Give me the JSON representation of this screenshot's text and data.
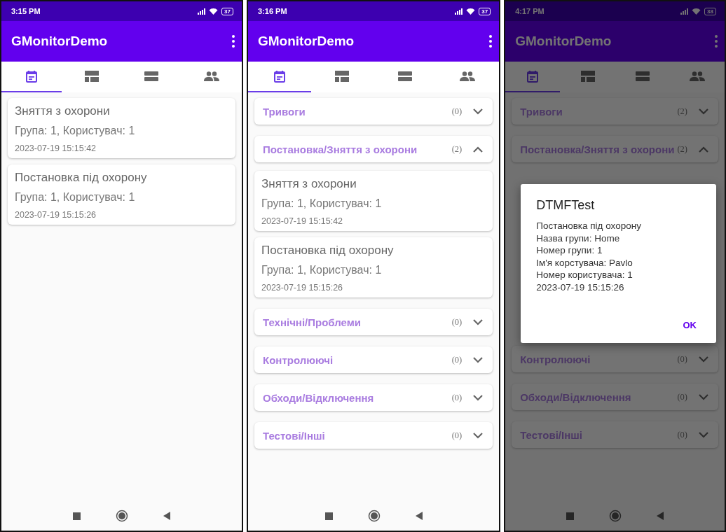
{
  "screens": [
    {
      "status_bar": {
        "time": "3:15 PM",
        "battery": "37"
      },
      "app_bar": {
        "title": "GMonitorDemo"
      },
      "tabs": [
        {
          "kind": "calendar",
          "selected": true
        },
        {
          "kind": "dashboard",
          "selected": false
        },
        {
          "kind": "list",
          "selected": false
        },
        {
          "kind": "people",
          "selected": false
        }
      ],
      "events": [
        {
          "title": "Зняття з охорони",
          "details": "Група: 1, Користувач: 1",
          "time": "2023-07-19 15:15:42"
        },
        {
          "title": "Постановка під охорону",
          "details": "Група: 1, Користувач: 1",
          "time": "2023-07-19 15:15:26"
        }
      ]
    },
    {
      "status_bar": {
        "time": "3:16 PM",
        "battery": "37"
      },
      "app_bar": {
        "title": "GMonitorDemo"
      },
      "tabs": [
        {
          "kind": "calendar",
          "selected": true
        },
        {
          "kind": "dashboard",
          "selected": false
        },
        {
          "kind": "list",
          "selected": false
        },
        {
          "kind": "people",
          "selected": false
        }
      ],
      "sections": [
        {
          "title": "Тривоги",
          "count": "(0)",
          "expanded": false
        },
        {
          "title": "Постановка/Зняття з охорони",
          "count": "(2)",
          "expanded": true,
          "events": [
            {
              "title": "Зняття з охорони",
              "details": "Група: 1, Користувач: 1",
              "time": "2023-07-19 15:15:42"
            },
            {
              "title": "Постановка під охорону",
              "details": "Група: 1, Користувач: 1",
              "time": "2023-07-19 15:15:26"
            }
          ]
        },
        {
          "title": "Технічні/Проблеми",
          "count": "(0)",
          "expanded": false
        },
        {
          "title": "Контролюючі",
          "count": "(0)",
          "expanded": false
        },
        {
          "title": "Обходи/Відключення",
          "count": "(0)",
          "expanded": false
        },
        {
          "title": "Тестові/Інші",
          "count": "(0)",
          "expanded": false
        }
      ]
    },
    {
      "status_bar": {
        "time": "4:17 PM",
        "battery": "38"
      },
      "app_bar": {
        "title": "GMonitorDemo"
      },
      "tabs": [
        {
          "kind": "calendar",
          "selected": true
        },
        {
          "kind": "dashboard",
          "selected": false
        },
        {
          "kind": "list",
          "selected": false
        },
        {
          "kind": "people",
          "selected": false
        }
      ],
      "sections": [
        {
          "title": "Тривоги",
          "count": "(2)",
          "expanded": false
        },
        {
          "title": "Постановка/Зняття з охорони",
          "count": "(2)",
          "expanded": true
        },
        {
          "title": "Контролюючі",
          "count": "(0)",
          "expanded": false
        },
        {
          "title": "Обходи/Відключення",
          "count": "(0)",
          "expanded": false
        },
        {
          "title": "Тестові/Інші",
          "count": "(0)",
          "expanded": false
        }
      ],
      "dialog": {
        "title": "DTMFTest",
        "message": "Постановка під охорону\nНазва групи: Home\nНомер групи: 1\nІм'я корстувача: Pavlo\nНомер користувача: 1\n2023-07-19 15:15:26",
        "button": "OK"
      }
    }
  ]
}
